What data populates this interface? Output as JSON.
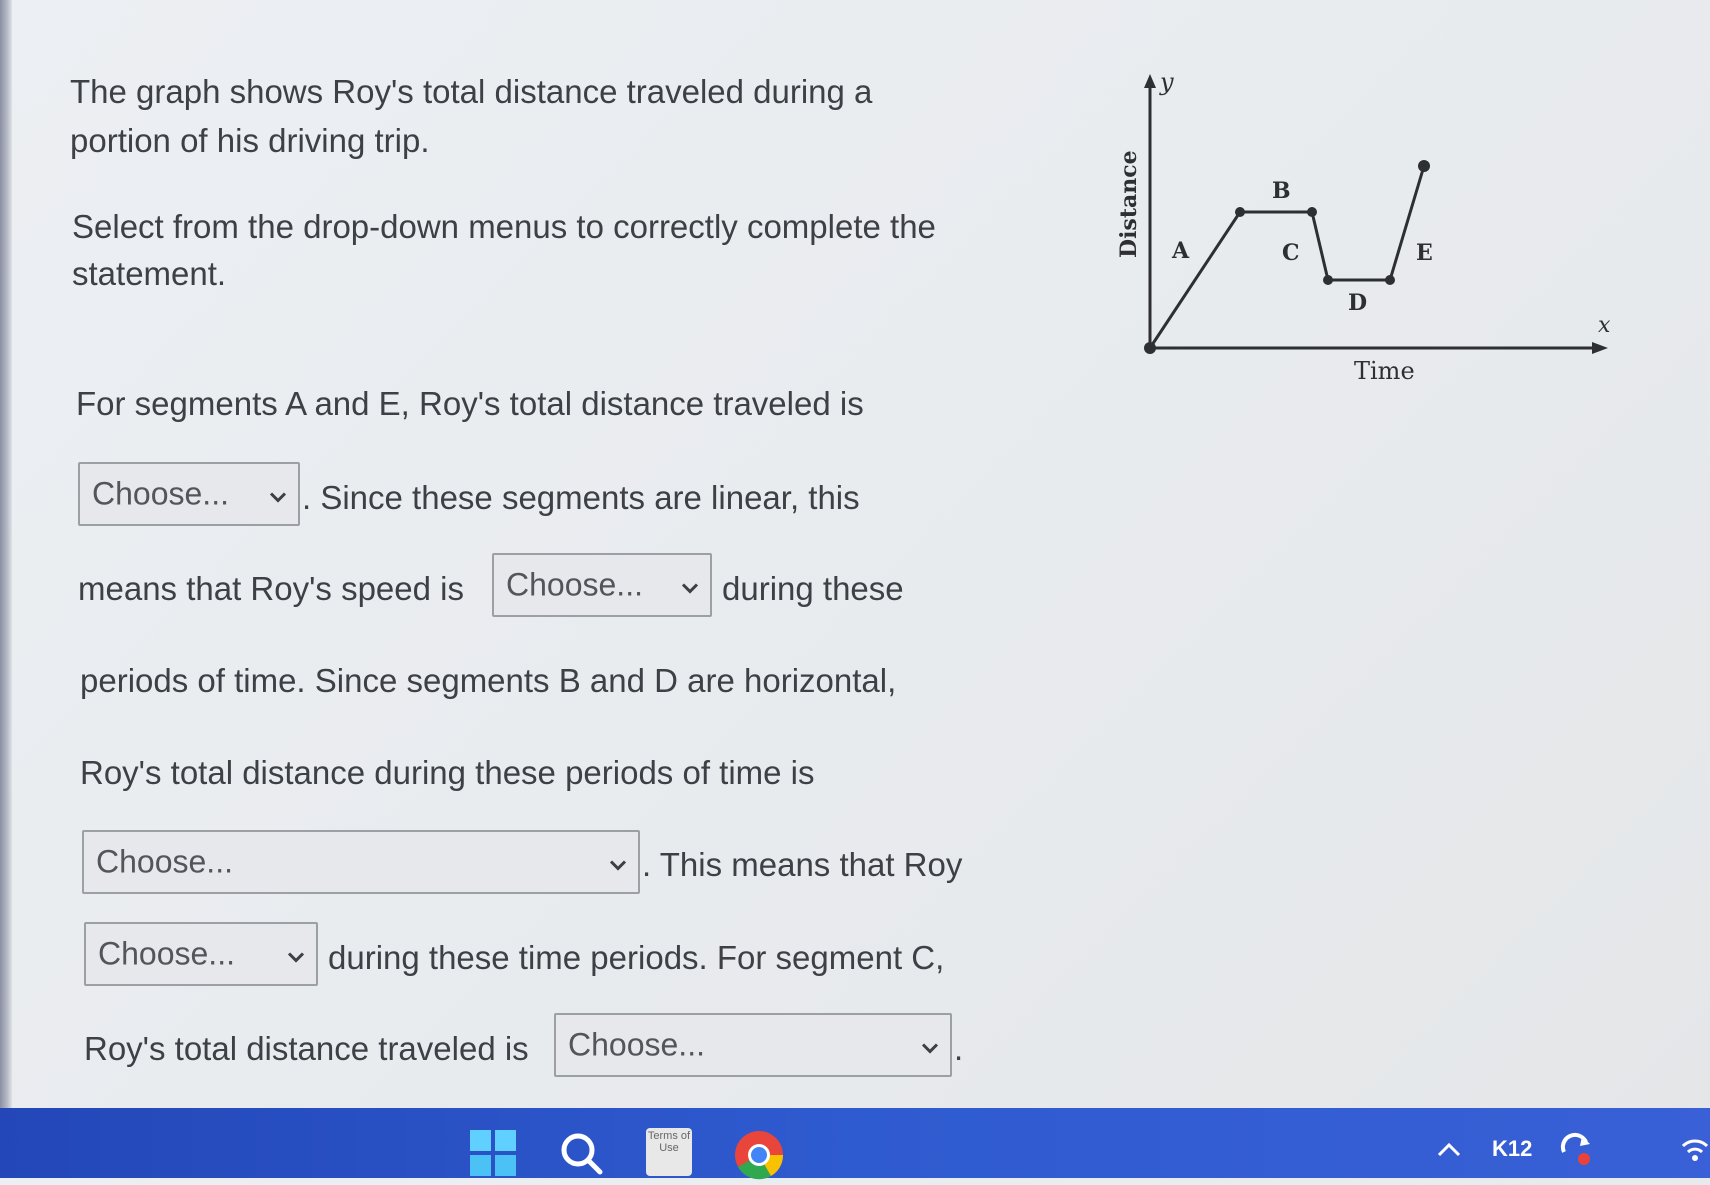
{
  "question": {
    "line1": "The graph shows Roy's total distance traveled during a",
    "line2": "portion of his driving trip.",
    "instr1": "Select from the drop-down menus to correctly complete the",
    "instr2": "statement."
  },
  "statement": {
    "s1": "For segments A and E, Roy's total distance traveled is",
    "s2": ". Since these segments are linear, this",
    "s3": "means that Roy's speed is",
    "s4": "during these",
    "s5": "periods of time. Since segments B and D are horizontal,",
    "s6": "Roy's total distance during these periods of time is",
    "s7": ". This means that Roy",
    "s8": "during these time periods. For segment C,",
    "s9": "Roy's total distance traveled is",
    "s10": "."
  },
  "dropdowns": {
    "d1": "Choose...",
    "d2": "Choose...",
    "d3": "Choose...",
    "d4": "Choose...",
    "d5": "Choose..."
  },
  "graph": {
    "y_label": "y",
    "x_label": "x",
    "ylabel": "Distance",
    "xlabel": "Time",
    "segments": [
      "A",
      "B",
      "C",
      "D",
      "E"
    ]
  },
  "taskbar": {
    "terms_label": "Terms of Use",
    "k12_label": "K12",
    "icons": [
      "windows-start-icon",
      "search-icon",
      "terms-of-use-icon",
      "chrome-icon",
      "chevron-up-icon",
      "k12-icon",
      "sync-icon",
      "wifi-icon"
    ]
  }
}
